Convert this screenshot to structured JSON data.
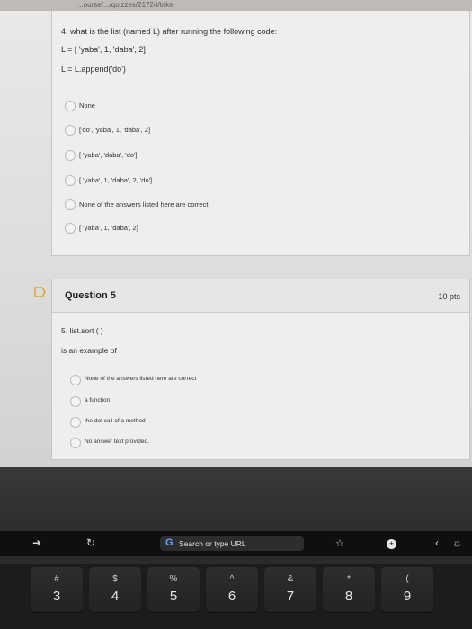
{
  "browser": {
    "url_fragment": "...ourse/.../quizzes/21724/take"
  },
  "q4": {
    "prompt": "4. what is the list (named L) after running the following code:",
    "code1": "L = [ 'yaba', 1, 'daba', 2]",
    "code2": "L = L.append('do')",
    "options": [
      "None",
      "['do', 'yaba', 1, 'daba', 2]",
      "[ 'yaba', 'daba', 'do']",
      "[ 'yaba', 1, 'daba', 2, 'do']",
      "None of the answers listed here are correct",
      "[ 'yaba', 1, 'daba', 2]"
    ]
  },
  "q5": {
    "title": "Question 5",
    "points": "10 pts",
    "prompt1": "5. list.sort ( )",
    "prompt2": "is an example of",
    "options": [
      "None of the answers listed here are correct",
      "a function",
      "the dot call of a method",
      "No answer text provided."
    ]
  },
  "touchbar": {
    "search_label": "Search or type URL",
    "icons": [
      "arrow-right-icon",
      "reload-icon",
      "google-icon",
      "star-icon",
      "plus-icon",
      "back-arrow-icon",
      "brightness-icon"
    ]
  },
  "keyboard": {
    "keys": [
      {
        "top": "#",
        "bottom": "3"
      },
      {
        "top": "$",
        "bottom": "4"
      },
      {
        "top": "%",
        "bottom": "5"
      },
      {
        "top": "^",
        "bottom": "6"
      },
      {
        "top": "&",
        "bottom": "7"
      },
      {
        "top": "*",
        "bottom": "8"
      },
      {
        "top": "(",
        "bottom": "9"
      }
    ]
  },
  "colors": {
    "accent": "#6aa3ff",
    "card_bg": "#efeeed"
  }
}
